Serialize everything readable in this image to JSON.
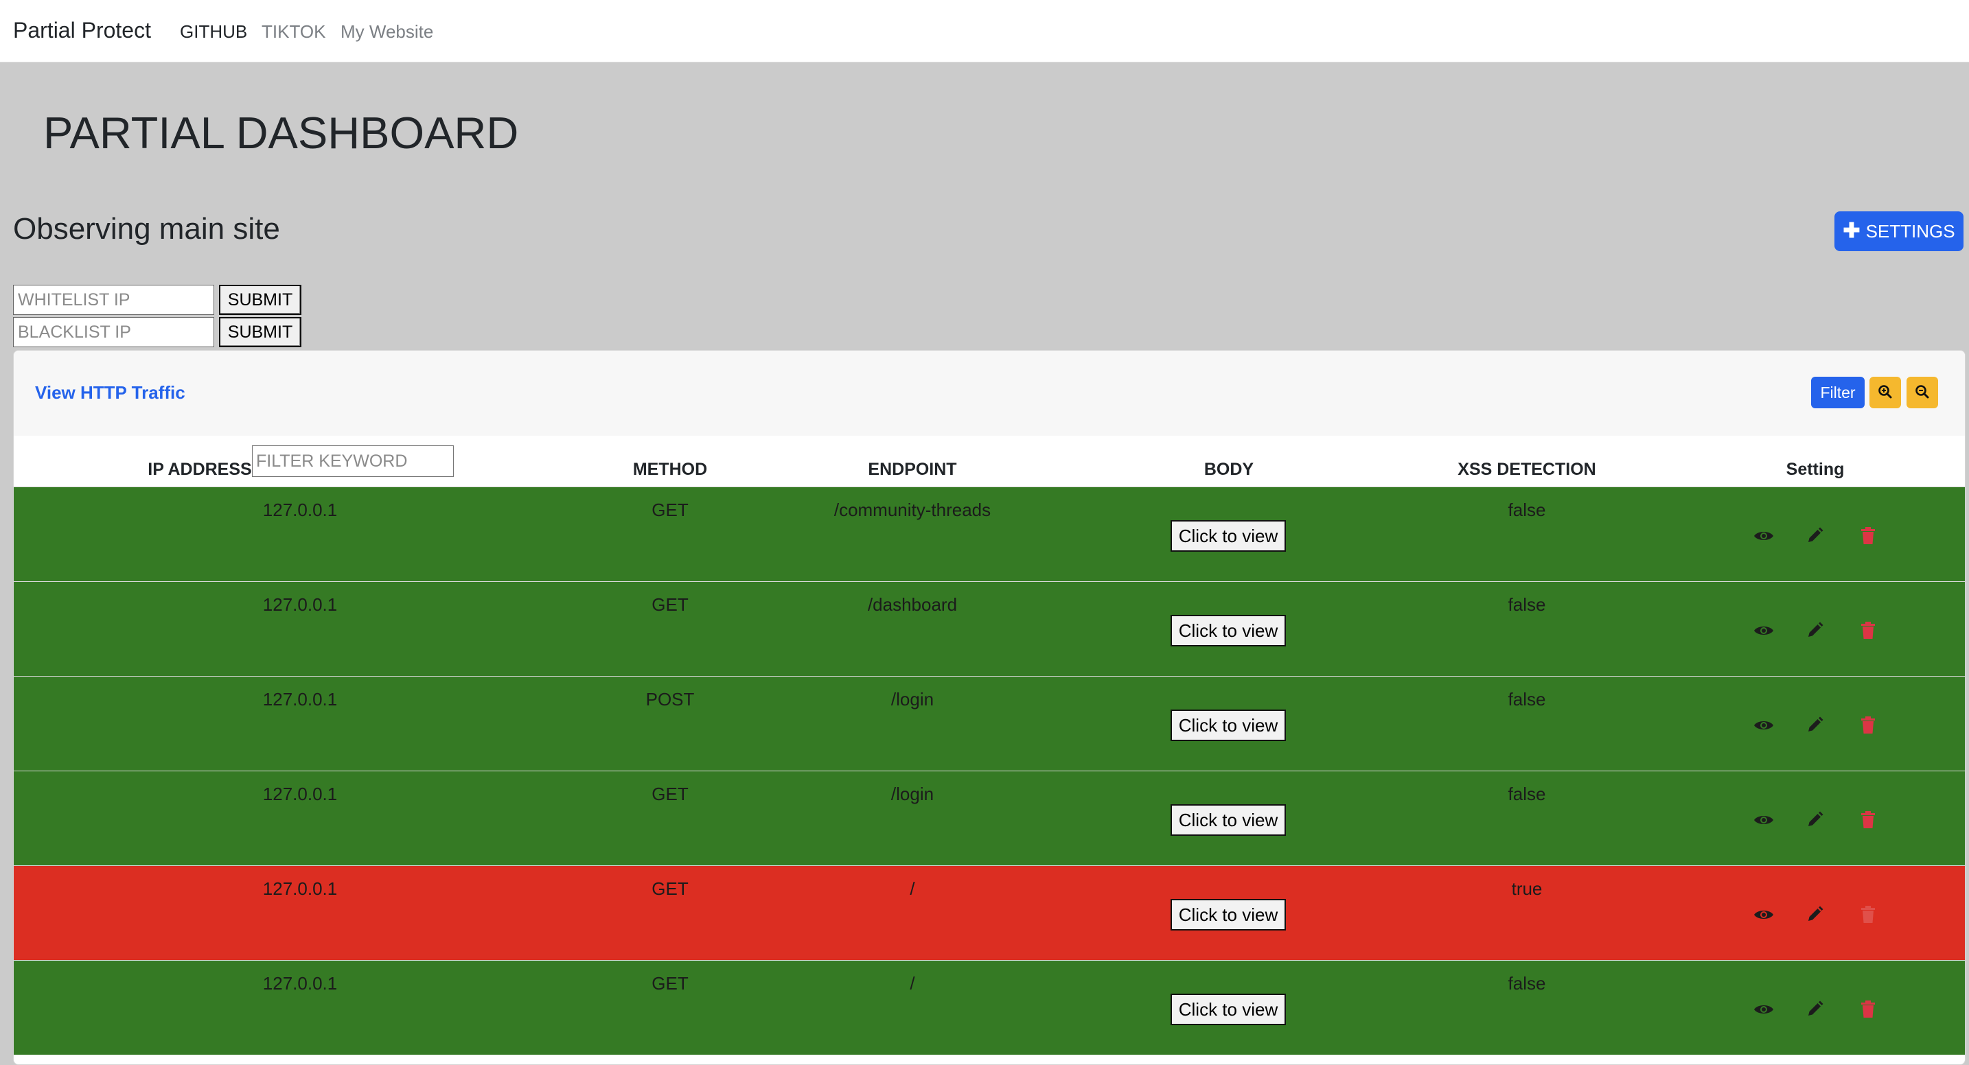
{
  "nav": {
    "brand": "Partial Protect",
    "links": [
      "GITHUB",
      "TIKTOK",
      "My Website"
    ]
  },
  "page": {
    "title": "PARTIAL DASHBOARD",
    "subtitle": "Observing main site",
    "settings_label": "SETTINGS"
  },
  "ip_forms": {
    "whitelist_placeholder": "WHITELIST IP",
    "blacklist_placeholder": "BLACKLIST IP",
    "submit_label": "SUBMIT"
  },
  "traffic": {
    "title": "View HTTP Traffic",
    "filter_label": "Filter",
    "filter_placeholder": "FILTER KEYWORD",
    "columns": [
      "IP ADDRESS",
      "METHOD",
      "ENDPOINT",
      "BODY",
      "XSS DETECTION",
      "Setting"
    ],
    "view_label": "Click to view",
    "rows": [
      {
        "ip": "127.0.0.1",
        "method": "GET",
        "endpoint": "/community-threads",
        "xss": "false",
        "status": "safe"
      },
      {
        "ip": "127.0.0.1",
        "method": "GET",
        "endpoint": "/dashboard",
        "xss": "false",
        "status": "safe"
      },
      {
        "ip": "127.0.0.1",
        "method": "POST",
        "endpoint": "/login",
        "xss": "false",
        "status": "safe"
      },
      {
        "ip": "127.0.0.1",
        "method": "GET",
        "endpoint": "/login",
        "xss": "false",
        "status": "safe"
      },
      {
        "ip": "127.0.0.1",
        "method": "GET",
        "endpoint": "/",
        "xss": "true",
        "status": "danger"
      },
      {
        "ip": "127.0.0.1",
        "method": "GET",
        "endpoint": "/",
        "xss": "false",
        "status": "safe"
      }
    ]
  },
  "colors": {
    "safe_row": "#357a24",
    "danger_row": "#dc2e22",
    "primary": "#2563eb",
    "warning": "#f5b82e"
  },
  "icons": [
    "plus-icon",
    "zoom-in-icon",
    "zoom-out-icon",
    "eye-icon",
    "pencil-icon",
    "trash-icon"
  ]
}
